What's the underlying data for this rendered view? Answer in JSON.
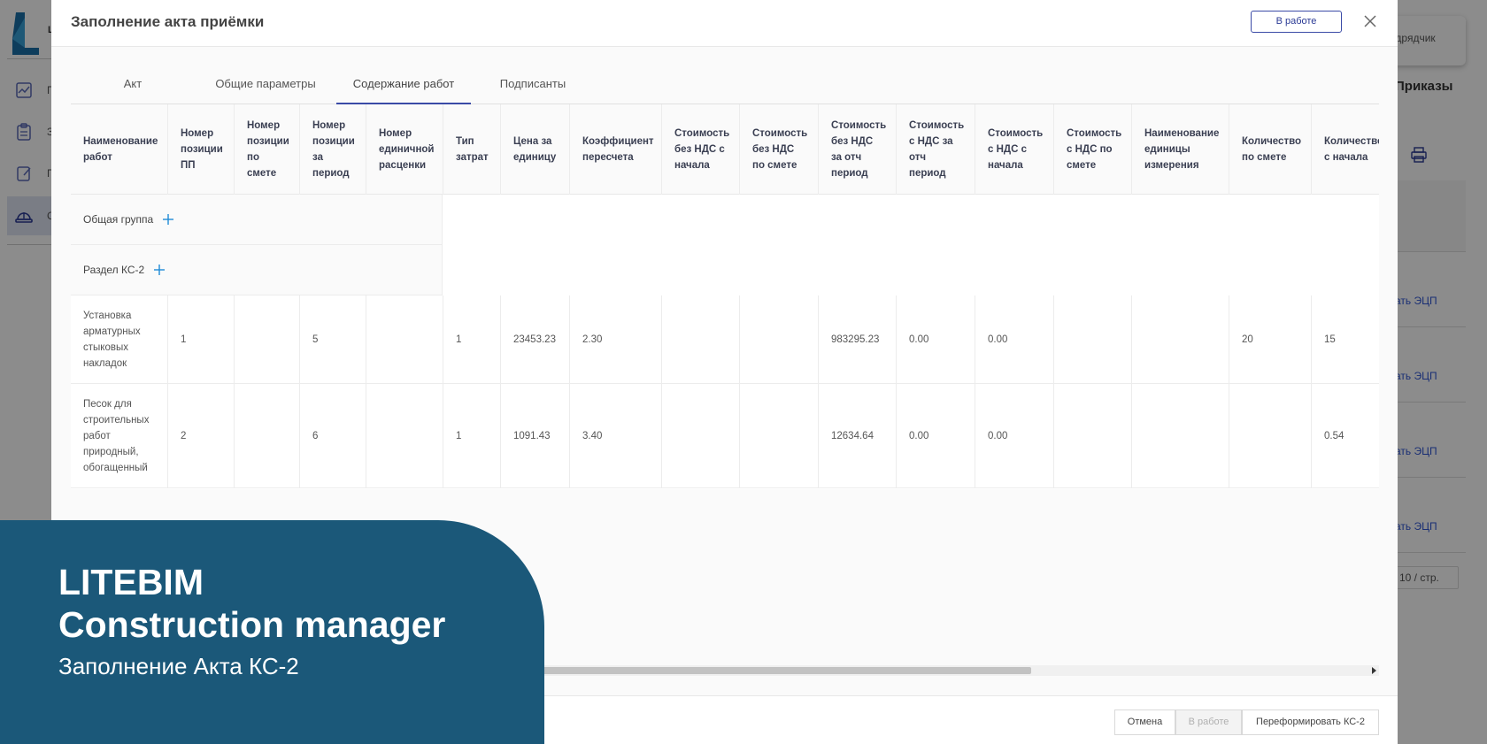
{
  "background": {
    "logo_letter": "L",
    "nav_letters": [
      "П",
      "З",
      "П",
      "С"
    ],
    "contractor_label": "одрядчик",
    "orders_title": "Приказы",
    "ecp_links": [
      "ать ЭЦП",
      "ать ЭЦП",
      "ать ЭЦП",
      "ать ЭЦП"
    ],
    "pager": "10 / стр."
  },
  "modal": {
    "title": "Заполнение акта приёмки",
    "status_label": "В работе",
    "tabs": [
      {
        "label": "Акт"
      },
      {
        "label": "Общие параметры"
      },
      {
        "label": "Содержание работ"
      },
      {
        "label": "Подписанты"
      }
    ],
    "active_tab": "Содержание работ"
  },
  "table": {
    "headers": [
      [
        "Наименование",
        "работ"
      ],
      [
        "Номер",
        "позиции",
        "ПП"
      ],
      [
        "Номер",
        "позиции",
        "по",
        "смете"
      ],
      [
        "Номер",
        "позиции",
        "за",
        "период"
      ],
      [
        "Номер",
        "единичной",
        "расценки"
      ],
      [
        "Тип",
        "затрат"
      ],
      [
        "Цена за",
        "единицу"
      ],
      [
        "Коэффициент",
        "пересчета"
      ],
      [
        "Стоимость",
        "без НДС с",
        "начала"
      ],
      [
        "Стоимость",
        "без НДС",
        "по смете"
      ],
      [
        "Стоимость",
        "без НДС",
        "за отч",
        "период"
      ],
      [
        "Стоимость",
        "с НДС за",
        "отч",
        "период"
      ],
      [
        "Стоимость",
        "с НДС с",
        "начала"
      ],
      [
        "Стоимость",
        "с НДС по",
        "смете"
      ],
      [
        "Наименование",
        "единицы",
        "измерения"
      ],
      [
        "Количество",
        "по смете"
      ],
      [
        "Количество",
        "с начала"
      ]
    ],
    "groups": [
      {
        "label": "Общая группа"
      },
      {
        "label": "Раздел КС-2"
      }
    ],
    "rows": [
      {
        "name": [
          "Установка",
          "арматурных",
          "стыковых",
          "накладок"
        ],
        "cells": [
          "1",
          "",
          "5",
          "",
          "1",
          "23453.23",
          "2.30",
          "",
          "",
          "983295.23",
          "0.00",
          "0.00",
          "",
          "",
          "20",
          "15"
        ]
      },
      {
        "name": [
          "Песок для",
          "строительных",
          "работ",
          "природный,",
          "обогащенный"
        ],
        "cells": [
          "2",
          "",
          "6",
          "",
          "1",
          "1091.43",
          "3.40",
          "",
          "",
          "12634.64",
          "0.00",
          "0.00",
          "",
          "",
          "",
          "0.54"
        ]
      }
    ]
  },
  "footer": {
    "cancel": "Отмена",
    "in_work": "В работе",
    "reform": "Переформировать КС-2"
  },
  "promo": {
    "brand": "LITEBIM",
    "product": "Construction manager",
    "subtitle": "Заполнение Акта КС-2"
  },
  "colors": {
    "accent": "#3a4aa6",
    "promo_bg": "#1b5879",
    "link": "#2f55d4"
  }
}
